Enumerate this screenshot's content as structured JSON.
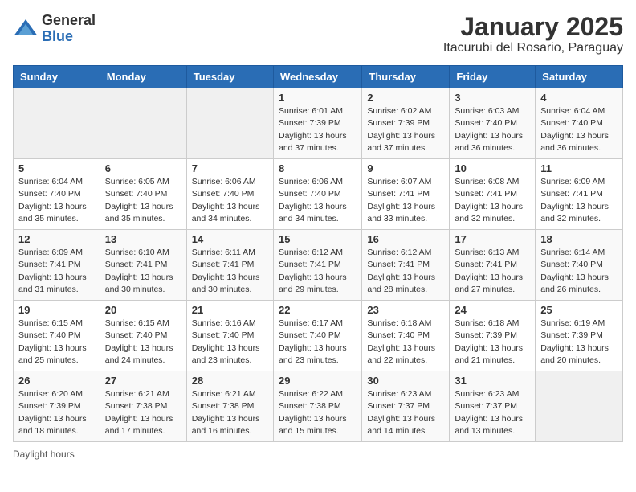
{
  "app": {
    "logo_line1": "General",
    "logo_line2": "Blue"
  },
  "header": {
    "title": "January 2025",
    "subtitle": "Itacurubi del Rosario, Paraguay"
  },
  "columns": [
    "Sunday",
    "Monday",
    "Tuesday",
    "Wednesday",
    "Thursday",
    "Friday",
    "Saturday"
  ],
  "weeks": [
    [
      {
        "day": "",
        "info": ""
      },
      {
        "day": "",
        "info": ""
      },
      {
        "day": "",
        "info": ""
      },
      {
        "day": "1",
        "info": "Sunrise: 6:01 AM\nSunset: 7:39 PM\nDaylight: 13 hours and 37 minutes."
      },
      {
        "day": "2",
        "info": "Sunrise: 6:02 AM\nSunset: 7:39 PM\nDaylight: 13 hours and 37 minutes."
      },
      {
        "day": "3",
        "info": "Sunrise: 6:03 AM\nSunset: 7:40 PM\nDaylight: 13 hours and 36 minutes."
      },
      {
        "day": "4",
        "info": "Sunrise: 6:04 AM\nSunset: 7:40 PM\nDaylight: 13 hours and 36 minutes."
      }
    ],
    [
      {
        "day": "5",
        "info": "Sunrise: 6:04 AM\nSunset: 7:40 PM\nDaylight: 13 hours and 35 minutes."
      },
      {
        "day": "6",
        "info": "Sunrise: 6:05 AM\nSunset: 7:40 PM\nDaylight: 13 hours and 35 minutes."
      },
      {
        "day": "7",
        "info": "Sunrise: 6:06 AM\nSunset: 7:40 PM\nDaylight: 13 hours and 34 minutes."
      },
      {
        "day": "8",
        "info": "Sunrise: 6:06 AM\nSunset: 7:40 PM\nDaylight: 13 hours and 34 minutes."
      },
      {
        "day": "9",
        "info": "Sunrise: 6:07 AM\nSunset: 7:41 PM\nDaylight: 13 hours and 33 minutes."
      },
      {
        "day": "10",
        "info": "Sunrise: 6:08 AM\nSunset: 7:41 PM\nDaylight: 13 hours and 32 minutes."
      },
      {
        "day": "11",
        "info": "Sunrise: 6:09 AM\nSunset: 7:41 PM\nDaylight: 13 hours and 32 minutes."
      }
    ],
    [
      {
        "day": "12",
        "info": "Sunrise: 6:09 AM\nSunset: 7:41 PM\nDaylight: 13 hours and 31 minutes."
      },
      {
        "day": "13",
        "info": "Sunrise: 6:10 AM\nSunset: 7:41 PM\nDaylight: 13 hours and 30 minutes."
      },
      {
        "day": "14",
        "info": "Sunrise: 6:11 AM\nSunset: 7:41 PM\nDaylight: 13 hours and 30 minutes."
      },
      {
        "day": "15",
        "info": "Sunrise: 6:12 AM\nSunset: 7:41 PM\nDaylight: 13 hours and 29 minutes."
      },
      {
        "day": "16",
        "info": "Sunrise: 6:12 AM\nSunset: 7:41 PM\nDaylight: 13 hours and 28 minutes."
      },
      {
        "day": "17",
        "info": "Sunrise: 6:13 AM\nSunset: 7:41 PM\nDaylight: 13 hours and 27 minutes."
      },
      {
        "day": "18",
        "info": "Sunrise: 6:14 AM\nSunset: 7:40 PM\nDaylight: 13 hours and 26 minutes."
      }
    ],
    [
      {
        "day": "19",
        "info": "Sunrise: 6:15 AM\nSunset: 7:40 PM\nDaylight: 13 hours and 25 minutes."
      },
      {
        "day": "20",
        "info": "Sunrise: 6:15 AM\nSunset: 7:40 PM\nDaylight: 13 hours and 24 minutes."
      },
      {
        "day": "21",
        "info": "Sunrise: 6:16 AM\nSunset: 7:40 PM\nDaylight: 13 hours and 23 minutes."
      },
      {
        "day": "22",
        "info": "Sunrise: 6:17 AM\nSunset: 7:40 PM\nDaylight: 13 hours and 23 minutes."
      },
      {
        "day": "23",
        "info": "Sunrise: 6:18 AM\nSunset: 7:40 PM\nDaylight: 13 hours and 22 minutes."
      },
      {
        "day": "24",
        "info": "Sunrise: 6:18 AM\nSunset: 7:39 PM\nDaylight: 13 hours and 21 minutes."
      },
      {
        "day": "25",
        "info": "Sunrise: 6:19 AM\nSunset: 7:39 PM\nDaylight: 13 hours and 20 minutes."
      }
    ],
    [
      {
        "day": "26",
        "info": "Sunrise: 6:20 AM\nSunset: 7:39 PM\nDaylight: 13 hours and 18 minutes."
      },
      {
        "day": "27",
        "info": "Sunrise: 6:21 AM\nSunset: 7:38 PM\nDaylight: 13 hours and 17 minutes."
      },
      {
        "day": "28",
        "info": "Sunrise: 6:21 AM\nSunset: 7:38 PM\nDaylight: 13 hours and 16 minutes."
      },
      {
        "day": "29",
        "info": "Sunrise: 6:22 AM\nSunset: 7:38 PM\nDaylight: 13 hours and 15 minutes."
      },
      {
        "day": "30",
        "info": "Sunrise: 6:23 AM\nSunset: 7:37 PM\nDaylight: 13 hours and 14 minutes."
      },
      {
        "day": "31",
        "info": "Sunrise: 6:23 AM\nSunset: 7:37 PM\nDaylight: 13 hours and 13 minutes."
      },
      {
        "day": "",
        "info": ""
      }
    ]
  ],
  "footer": {
    "label": "Daylight hours"
  }
}
